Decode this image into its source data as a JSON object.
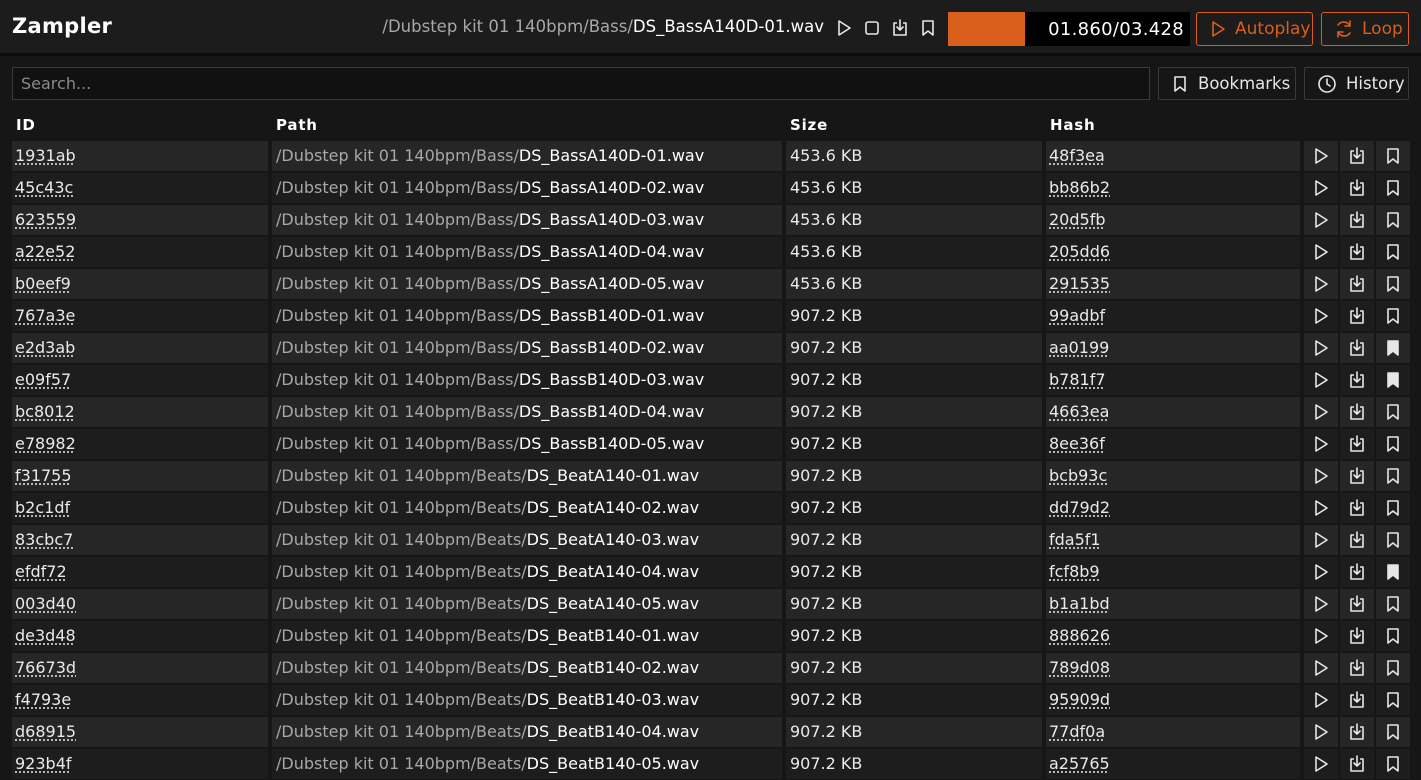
{
  "app": {
    "title": "Zampler"
  },
  "now_playing": {
    "dir": "/Dubstep kit 01 140bpm/Bass/",
    "file": "DS_BassA140D-01.wav",
    "time": "01.860/03.428",
    "progress_fraction": 0.318
  },
  "toolbar": {
    "autoplay_label": "Autoplay",
    "loop_label": "Loop"
  },
  "search": {
    "placeholder": "Search...",
    "value": ""
  },
  "buttons": {
    "bookmarks_label": "Bookmarks",
    "history_label": "History"
  },
  "columns": {
    "id": "ID",
    "path": "Path",
    "size": "Size",
    "hash": "Hash"
  },
  "colors": {
    "accent": "#d95f1c",
    "background": "#161616",
    "row_even": "#262626",
    "row_odd": "#1d1d1d"
  },
  "icons": {
    "play": "play-icon",
    "download": "download-icon",
    "bookmark": "bookmark-icon",
    "stop": "stop-icon",
    "history": "clock-icon",
    "loop": "loop-icon"
  },
  "rows": [
    {
      "id": "1931ab",
      "dir": "/Dubstep kit 01 140bpm/Bass/",
      "file": "DS_BassA140D-01.wav",
      "size": "453.6 KB",
      "hash": "48f3ea",
      "bookmarked": false
    },
    {
      "id": "45c43c",
      "dir": "/Dubstep kit 01 140bpm/Bass/",
      "file": "DS_BassA140D-02.wav",
      "size": "453.6 KB",
      "hash": "bb86b2",
      "bookmarked": false
    },
    {
      "id": "623559",
      "dir": "/Dubstep kit 01 140bpm/Bass/",
      "file": "DS_BassA140D-03.wav",
      "size": "453.6 KB",
      "hash": "20d5fb",
      "bookmarked": false
    },
    {
      "id": "a22e52",
      "dir": "/Dubstep kit 01 140bpm/Bass/",
      "file": "DS_BassA140D-04.wav",
      "size": "453.6 KB",
      "hash": "205dd6",
      "bookmarked": false
    },
    {
      "id": "b0eef9",
      "dir": "/Dubstep kit 01 140bpm/Bass/",
      "file": "DS_BassA140D-05.wav",
      "size": "453.6 KB",
      "hash": "291535",
      "bookmarked": false
    },
    {
      "id": "767a3e",
      "dir": "/Dubstep kit 01 140bpm/Bass/",
      "file": "DS_BassB140D-01.wav",
      "size": "907.2 KB",
      "hash": "99adbf",
      "bookmarked": false
    },
    {
      "id": "e2d3ab",
      "dir": "/Dubstep kit 01 140bpm/Bass/",
      "file": "DS_BassB140D-02.wav",
      "size": "907.2 KB",
      "hash": "aa0199",
      "bookmarked": true
    },
    {
      "id": "e09f57",
      "dir": "/Dubstep kit 01 140bpm/Bass/",
      "file": "DS_BassB140D-03.wav",
      "size": "907.2 KB",
      "hash": "b781f7",
      "bookmarked": true
    },
    {
      "id": "bc8012",
      "dir": "/Dubstep kit 01 140bpm/Bass/",
      "file": "DS_BassB140D-04.wav",
      "size": "907.2 KB",
      "hash": "4663ea",
      "bookmarked": false
    },
    {
      "id": "e78982",
      "dir": "/Dubstep kit 01 140bpm/Bass/",
      "file": "DS_BassB140D-05.wav",
      "size": "907.2 KB",
      "hash": "8ee36f",
      "bookmarked": false
    },
    {
      "id": "f31755",
      "dir": "/Dubstep kit 01 140bpm/Beats/",
      "file": "DS_BeatA140-01.wav",
      "size": "907.2 KB",
      "hash": "bcb93c",
      "bookmarked": false
    },
    {
      "id": "b2c1df",
      "dir": "/Dubstep kit 01 140bpm/Beats/",
      "file": "DS_BeatA140-02.wav",
      "size": "907.2 KB",
      "hash": "dd79d2",
      "bookmarked": false
    },
    {
      "id": "83cbc7",
      "dir": "/Dubstep kit 01 140bpm/Beats/",
      "file": "DS_BeatA140-03.wav",
      "size": "907.2 KB",
      "hash": "fda5f1",
      "bookmarked": false
    },
    {
      "id": "efdf72",
      "dir": "/Dubstep kit 01 140bpm/Beats/",
      "file": "DS_BeatA140-04.wav",
      "size": "907.2 KB",
      "hash": "fcf8b9",
      "bookmarked": true
    },
    {
      "id": "003d40",
      "dir": "/Dubstep kit 01 140bpm/Beats/",
      "file": "DS_BeatA140-05.wav",
      "size": "907.2 KB",
      "hash": "b1a1bd",
      "bookmarked": false
    },
    {
      "id": "de3d48",
      "dir": "/Dubstep kit 01 140bpm/Beats/",
      "file": "DS_BeatB140-01.wav",
      "size": "907.2 KB",
      "hash": "888626",
      "bookmarked": false
    },
    {
      "id": "76673d",
      "dir": "/Dubstep kit 01 140bpm/Beats/",
      "file": "DS_BeatB140-02.wav",
      "size": "907.2 KB",
      "hash": "789d08",
      "bookmarked": false
    },
    {
      "id": "f4793e",
      "dir": "/Dubstep kit 01 140bpm/Beats/",
      "file": "DS_BeatB140-03.wav",
      "size": "907.2 KB",
      "hash": "95909d",
      "bookmarked": false
    },
    {
      "id": "d68915",
      "dir": "/Dubstep kit 01 140bpm/Beats/",
      "file": "DS_BeatB140-04.wav",
      "size": "907.2 KB",
      "hash": "77df0a",
      "bookmarked": false
    },
    {
      "id": "923b4f",
      "dir": "/Dubstep kit 01 140bpm/Beats/",
      "file": "DS_BeatB140-05.wav",
      "size": "907.2 KB",
      "hash": "a25765",
      "bookmarked": false
    }
  ]
}
